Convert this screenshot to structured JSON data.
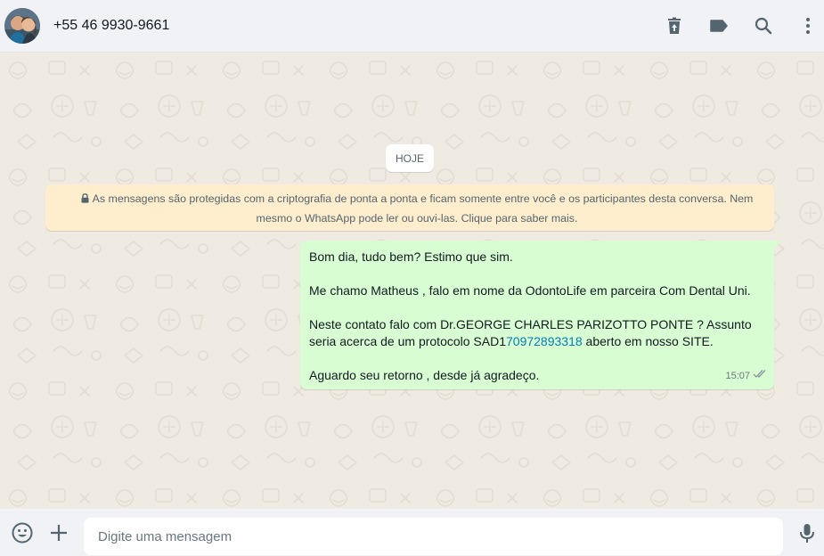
{
  "header": {
    "contact_name": "+55 46 9930-9661",
    "icons": [
      "delete-icon",
      "label-icon",
      "search-icon",
      "menu-icon"
    ]
  },
  "chat": {
    "date_chip": "HOJE",
    "encryption_notice": "As mensagens são protegidas com a criptografia de ponta a ponta e ficam somente entre você e os participantes desta conversa. Nem mesmo o WhatsApp pode ler ou ouvi-las. Clique para saber mais.",
    "message": {
      "line1": "Bom dia, tudo bem? Estimo que sim.",
      "line2": "Me chamo Matheus , falo em nome da OdontoLife em parceira Com Dental Uni.",
      "line3_pre": "Neste contato falo com Dr.GEORGE CHARLES PARIZOTTO PONTE ? Assunto seria acerca de um protocolo SAD1",
      "line3_link": "70972893318",
      "line3_post": " aberto em nosso SITE.",
      "line4": "Aguardo seu retorno , desde já agradeço.",
      "time": "15:07",
      "status": "read"
    }
  },
  "footer": {
    "placeholder": "Digite uma mensagem",
    "value": ""
  },
  "colors": {
    "header_bg": "#f0f2f5",
    "chat_bg": "#efeae2",
    "outgoing_bubble": "#d9fdd3",
    "system_notice": "#ffeecd",
    "icon": "#54656f",
    "link": "#027eb5"
  }
}
